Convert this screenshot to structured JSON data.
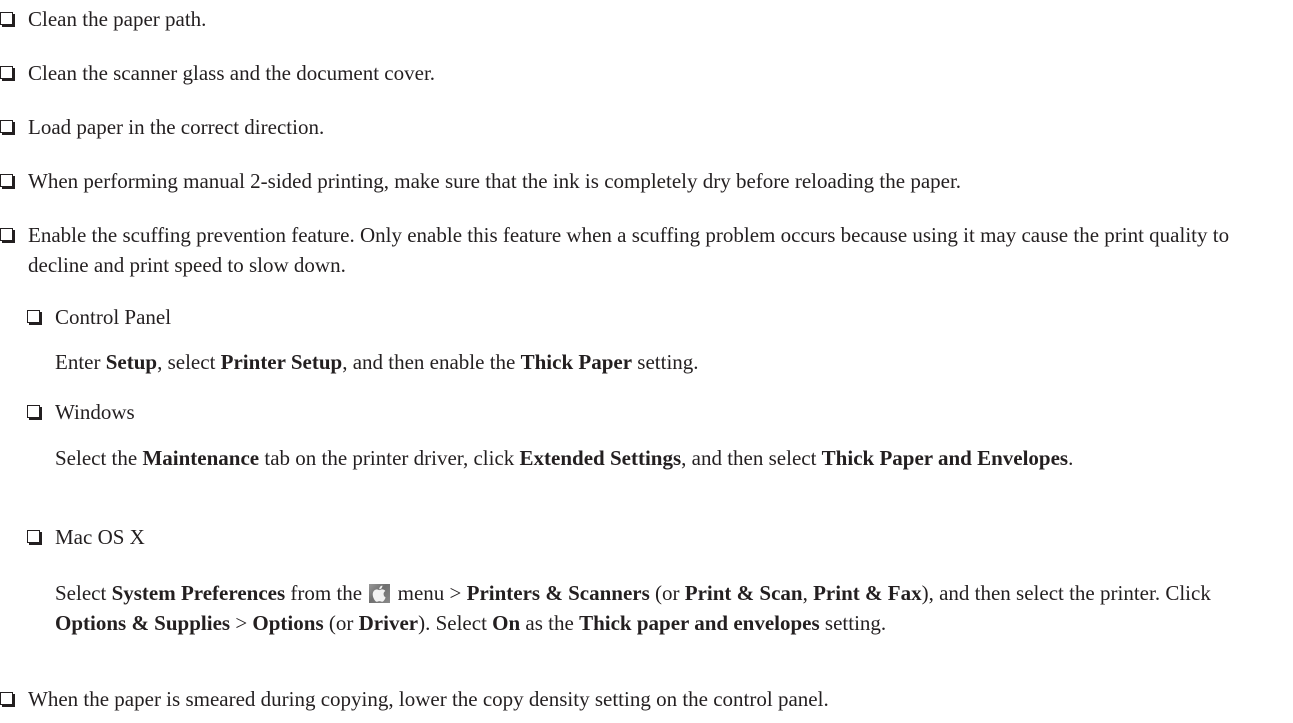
{
  "items": {
    "clean_paper_path": "Clean the paper path.",
    "clean_scanner": "Clean the scanner glass and the document cover.",
    "load_paper": "Load paper in the correct direction.",
    "manual_duplex": "When performing manual 2-sided printing, make sure that the ink is completely dry before reloading the paper.",
    "scuff_prevention": "Enable the scuffing prevention feature. Only enable this feature when a scuffing problem occurs because using it may cause the print quality to decline and print speed to slow down.",
    "copy_density": "When the paper is smeared during copying, lower the copy density setting on the control panel."
  },
  "control_panel": {
    "heading": "Control Panel",
    "t1": "Enter ",
    "b1": "Setup",
    "t2": ", select ",
    "b2": "Printer Setup",
    "t3": ", and then enable the ",
    "b3": "Thick Paper",
    "t4": " setting."
  },
  "windows": {
    "heading": "Windows",
    "t1": "Select the ",
    "b1": "Maintenance",
    "t2": " tab on the printer driver, click ",
    "b2": "Extended Settings",
    "t3": ", and then select ",
    "b3": "Thick Paper and Envelopes",
    "t4": "."
  },
  "mac": {
    "heading": "Mac OS X",
    "t1": "Select ",
    "b1": "System Preferences",
    "t2": " from the ",
    "icon": "apple-menu-icon",
    "t3": " menu > ",
    "b2": "Printers & Scanners",
    "t4": " (or ",
    "b3": "Print & Scan",
    "t5": ", ",
    "b4": "Print & Fax",
    "t6": "), and then select the printer. Click ",
    "b5": "Options & Supplies",
    "t7": " > ",
    "b6": "Options",
    "t8": " (or ",
    "b7": "Driver",
    "t9": "). Select ",
    "b8": "On",
    "t10": " as the ",
    "b9": "Thick paper and envelopes",
    "t11": " setting."
  }
}
